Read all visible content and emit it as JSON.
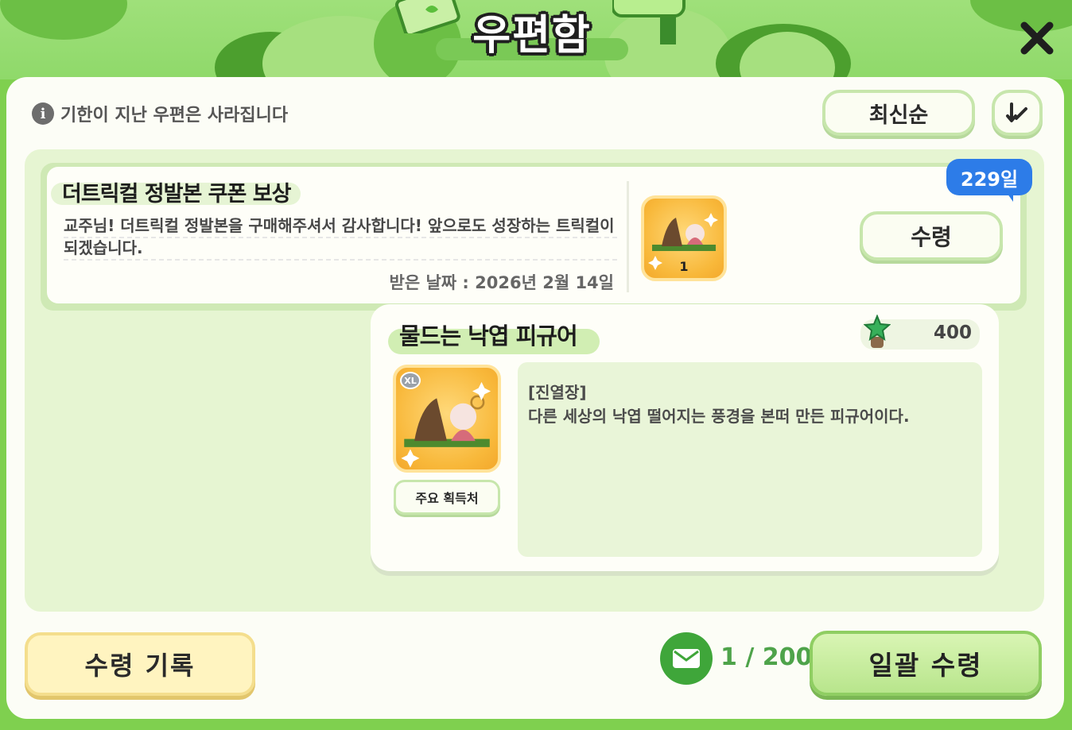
{
  "header": {
    "title": "우편함"
  },
  "notice": {
    "text": "기한이 지난 우편은 사라집니다"
  },
  "sort": {
    "label": "최신순"
  },
  "mail": {
    "title": "더트릭컬 정발본 쿠폰 보상",
    "body": "교주님! 더트릭컬 정발본을 구매해주셔서 감사합니다! 앞으로도 성장하는 트릭컬이 되겠습니다.",
    "date": "받은 날짜 : 2026년 2월 14일",
    "item_count": "1",
    "days_left": "229일",
    "receive_label": "수령"
  },
  "item_popup": {
    "name": "물드는 낙엽 피규어",
    "price": "400",
    "size_badge": "XL",
    "source_label": "주요 획득처",
    "desc_tag": "[진열장]",
    "desc_text": "다른 세상의 낙엽 떨어지는 풍경을 본떠 만든 피규어이다."
  },
  "footer": {
    "history_label": "수령 기록",
    "mail_count": "1 / 200",
    "receive_all_label": "일괄 수령"
  },
  "colors": {
    "brand_green": "#7fd04f",
    "badge_blue": "#2d7ce8",
    "history_yellow": "#fff4c0"
  }
}
